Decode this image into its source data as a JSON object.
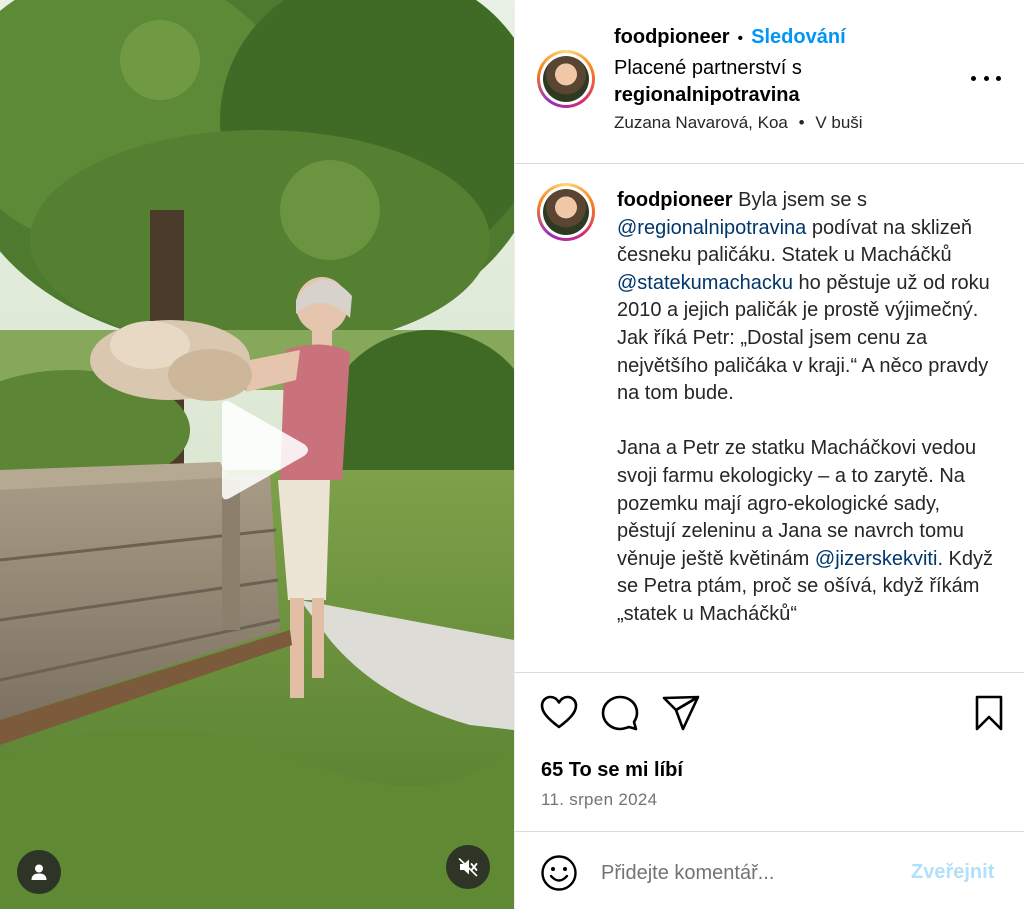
{
  "media": {
    "type": "video",
    "play_icon": "play-icon",
    "user_tag_icon": "person-icon",
    "mute_icon": "speaker-muted-icon"
  },
  "header": {
    "username": "foodpioneer",
    "separator": "•",
    "follow_label": "Sledování",
    "paid_partnership_text": "Placené partnerství s",
    "partner": "regionalnipotravina",
    "audio_people": "Zuzana Navarová, Koa",
    "audio_separator": "•",
    "location": "V buši",
    "more_icon": "more-dots-icon"
  },
  "caption": {
    "username": "foodpioneer",
    "p1_a": " Byla jsem se s ",
    "mention_1": "@regionalnipotravina",
    "p1_b": " podívat na sklizeň česneku paličáku. Statek u Macháčků ",
    "mention_2": "@statekumachacku",
    "p1_c": " ho pěstuje už od roku 2010 a jejich paličák je prostě výjimečný. Jak říká Petr: „Dostal jsem cenu za největšího paličáka v kraji.“ A něco pravdy na tom bude.",
    "p2_a": "Jana a Petr ze statku Macháčkovi vedou svoji farmu ekologicky – a to zarytě. Na pozemku mají agro-ekologické sady, pěstují zeleninu a Jana se navrch tomu věnuje ještě květinám ",
    "mention_3": "@jizerskekviti",
    "p2_b": ". Když se Petra ptám, proč se ošívá, když říkám „statek u Macháčků“"
  },
  "actions": {
    "like_icon": "heart-icon",
    "comment_icon": "comment-icon",
    "share_icon": "send-icon",
    "save_icon": "bookmark-icon",
    "likes_text": "65 To se mi líbí",
    "date": "11. srpen 2024"
  },
  "comment": {
    "emoji_icon": "emoji-icon",
    "placeholder": "Přidejte komentář...",
    "post_label": "Zveřejnit"
  },
  "colors": {
    "follow": "#0095f6",
    "mention": "#00376b",
    "post_disabled": "#b2dffc",
    "secondary_text": "#737373",
    "divider": "#dbdbdb"
  }
}
